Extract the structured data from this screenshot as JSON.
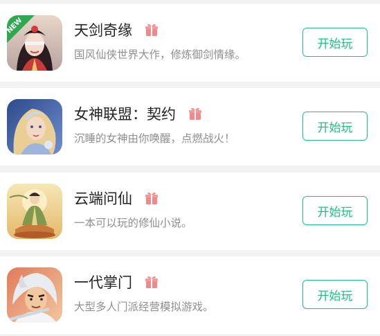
{
  "games": [
    {
      "title": "天剑奇缘",
      "description": "国风仙侠世界大作，修炼御剑情缘。",
      "button_label": "开始玩",
      "badge": "NEW",
      "icon": "game-icon-tianjianqiyuan"
    },
    {
      "title": "女神联盟：契约",
      "description": "沉睡的女神由你唤醒，点燃战火！",
      "button_label": "开始玩",
      "icon": "game-icon-nvshenlianmeng"
    },
    {
      "title": "云端问仙",
      "description": "一本可以玩的修仙小说。",
      "button_label": "开始玩",
      "icon": "game-icon-yunduanwenxian"
    },
    {
      "title": "一代掌门",
      "description": "大型多人门派经营模拟游戏。",
      "button_label": "开始玩",
      "icon": "game-icon-yidaizhangmen"
    }
  ],
  "colors": {
    "accent": "#1fbf83",
    "gift": "#f08a8a",
    "badge": "#2fa84f",
    "title": "#222222",
    "desc": "#8f8f8f"
  }
}
